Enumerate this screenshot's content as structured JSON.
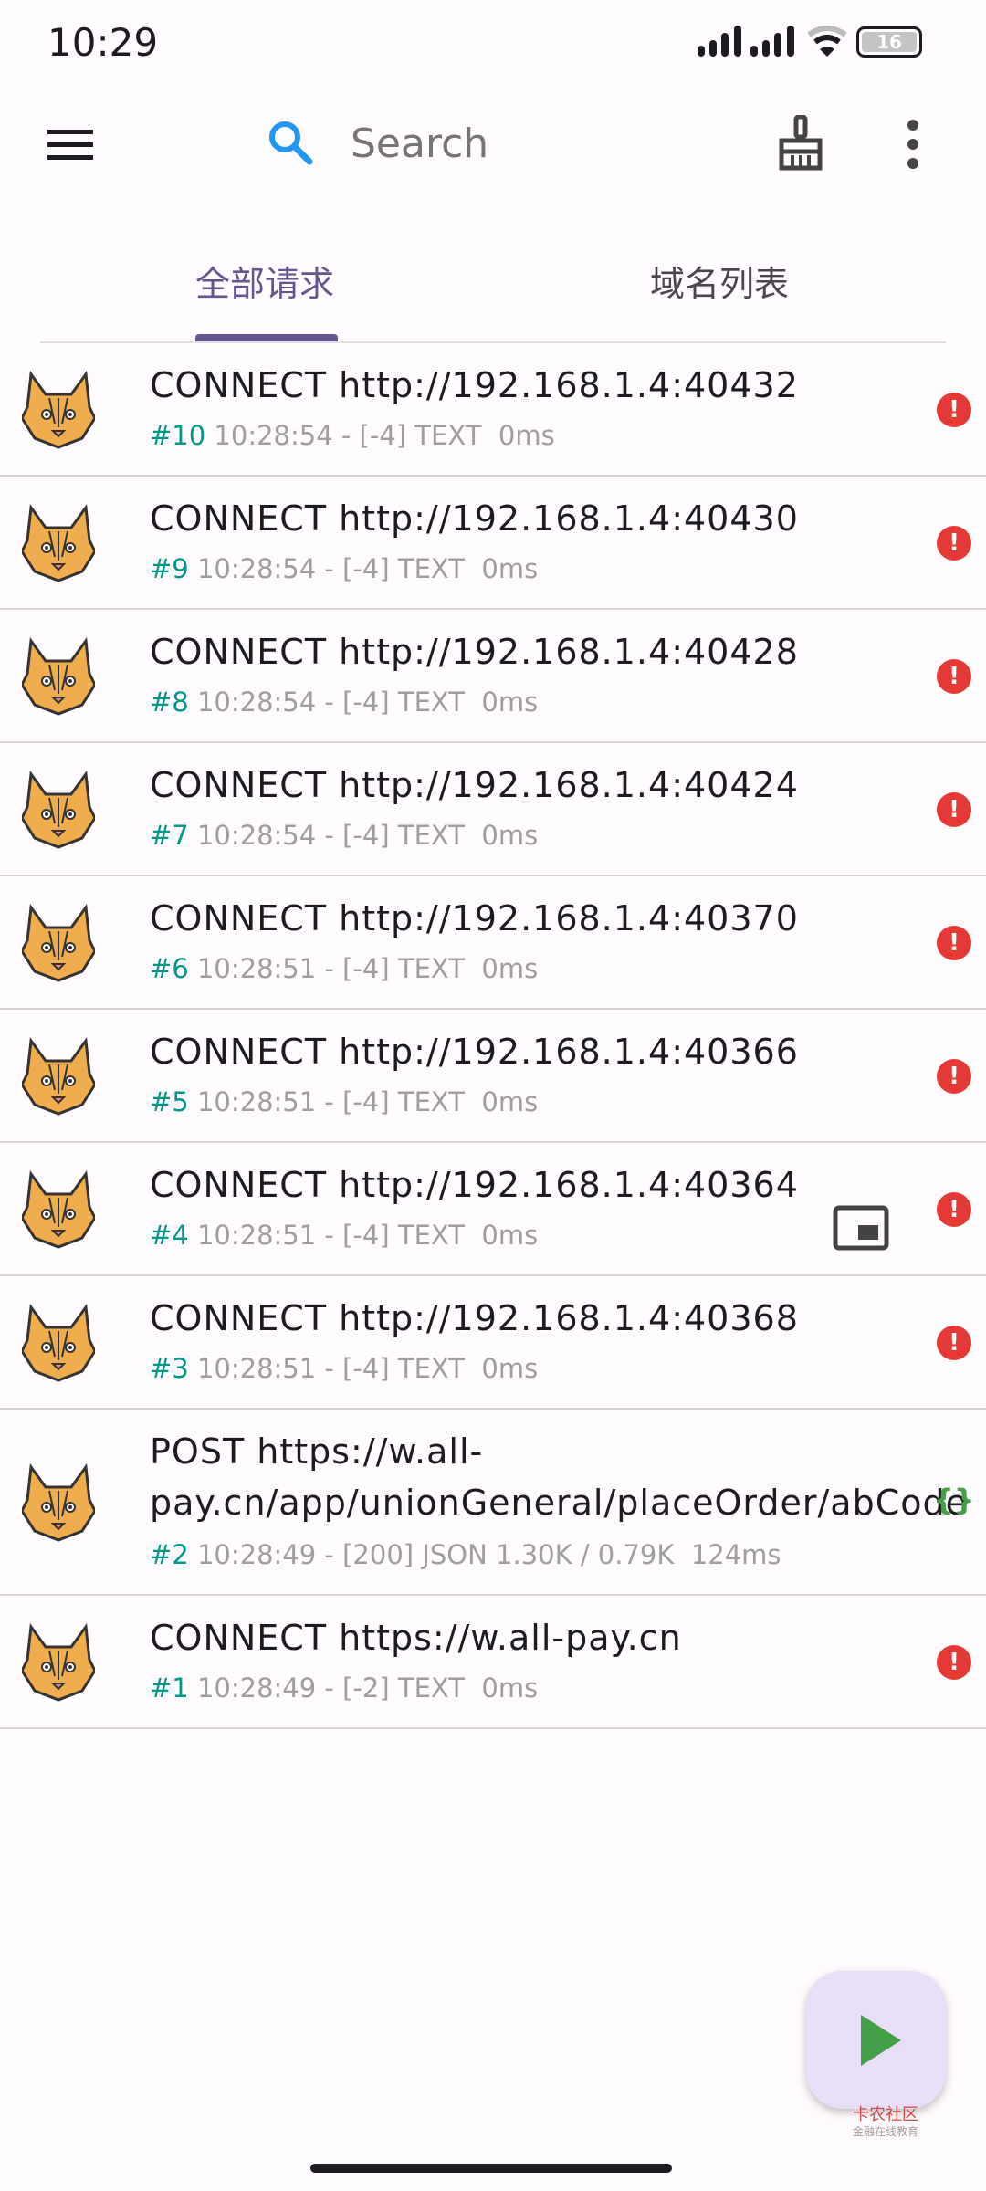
{
  "status_bar": {
    "time": "10:29",
    "battery": "16"
  },
  "toolbar": {
    "search_placeholder": "Search",
    "icons": [
      "menu-icon",
      "search-icon",
      "broom-icon",
      "more-vert-icon"
    ]
  },
  "tabs": [
    {
      "label": "全部请求",
      "active": true
    },
    {
      "label": "域名列表",
      "active": false
    }
  ],
  "requests": [
    {
      "title": "CONNECT http://192.168.1.4:40432",
      "num": "#10",
      "meta": " 10:28:54 - [-4] TEXT  0ms",
      "status": "error"
    },
    {
      "title": "CONNECT http://192.168.1.4:40430",
      "num": "#9",
      "meta": " 10:28:54 - [-4] TEXT  0ms",
      "status": "error"
    },
    {
      "title": "CONNECT http://192.168.1.4:40428",
      "num": "#8",
      "meta": " 10:28:54 - [-4] TEXT  0ms",
      "status": "error"
    },
    {
      "title": "CONNECT http://192.168.1.4:40424",
      "num": "#7",
      "meta": " 10:28:54 - [-4] TEXT  0ms",
      "status": "error"
    },
    {
      "title": "CONNECT http://192.168.1.4:40370",
      "num": "#6",
      "meta": " 10:28:51 - [-4] TEXT  0ms",
      "status": "error"
    },
    {
      "title": "CONNECT http://192.168.1.4:40366",
      "num": "#5",
      "meta": " 10:28:51 - [-4] TEXT  0ms",
      "status": "error"
    },
    {
      "title": "CONNECT http://192.168.1.4:40364",
      "num": "#4",
      "meta": " 10:28:51 - [-4] TEXT  0ms",
      "status": "error"
    },
    {
      "title": "CONNECT http://192.168.1.4:40368",
      "num": "#3",
      "meta": " 10:28:51 - [-4] TEXT  0ms",
      "status": "error"
    },
    {
      "title": "POST https://w.all-pay.cn/app/unionGeneral/placeOrder/abCode",
      "num": "#2",
      "meta": " 10:28:49 - [200] JSON 1.30K / 0.79K  124ms",
      "status": "json"
    },
    {
      "title": "CONNECT https://w.all-pay.cn",
      "num": "#1",
      "meta": " 10:28:49 - [-2] TEXT  0ms",
      "status": "error"
    }
  ],
  "json_glyph": "{}",
  "error_glyph": "!",
  "watermark": {
    "line1": "卡农社区",
    "line2": "金融在线教育"
  },
  "colors": {
    "accent": "#65558f",
    "id": "#009688",
    "error": "#e53935",
    "json": "#43a047",
    "fab": "#e8def8"
  }
}
